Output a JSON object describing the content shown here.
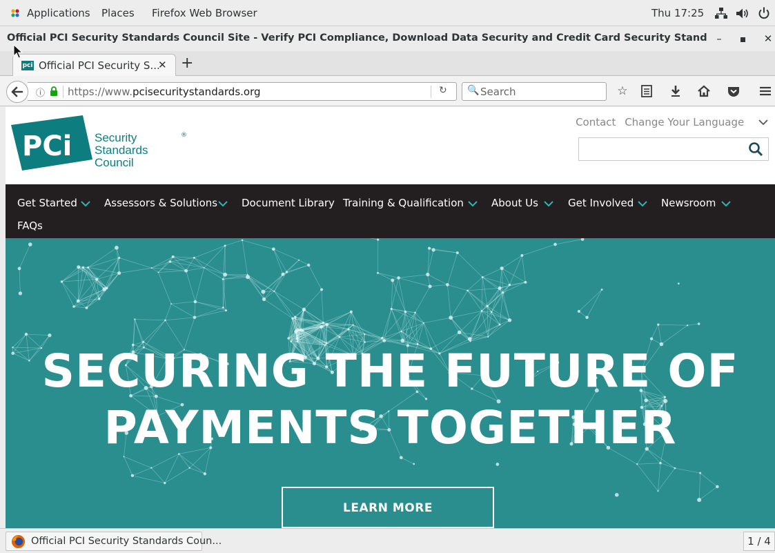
{
  "topbar": {
    "applications": "Applications",
    "places": "Places",
    "app_name": "Firefox Web Browser",
    "clock": "Thu 17:25"
  },
  "window": {
    "title": "Official PCI Security Standards Council Site - Verify PCI Compliance, Download Data Security and Credit Card Security Standards - Moz..."
  },
  "tab": {
    "label": "Official PCI Security S...",
    "favicon_text": "pci"
  },
  "navbar": {
    "url_prefix": "https://www.",
    "url_domain": "pcisecuritystandards.org",
    "search_placeholder": "Search"
  },
  "site": {
    "logo_text": "PCi",
    "logo_line1": "Security",
    "logo_line2": "Standards Council",
    "contact": "Contact",
    "language": "Change Your Language",
    "menu": [
      {
        "label": "Get Started"
      },
      {
        "label": "Assessors & Solutions"
      },
      {
        "label": "Document Library"
      },
      {
        "label": "Training & Qualification"
      },
      {
        "label": "About Us"
      },
      {
        "label": "Get Involved"
      },
      {
        "label": "Newsroom"
      },
      {
        "label": "FAQs"
      }
    ],
    "hero_line1": "SECURING THE FUTURE OF",
    "hero_line2": "PAYMENTS TOGETHER",
    "cta": "LEARN MORE"
  },
  "taskbar": {
    "window_label": "Official PCI Security Standards Coun...",
    "workspace": "1 / 4"
  },
  "colors": {
    "brand_teal": "#0e7d7f",
    "hero_teal": "#2a8e8f",
    "nav_dark": "#231f20"
  }
}
